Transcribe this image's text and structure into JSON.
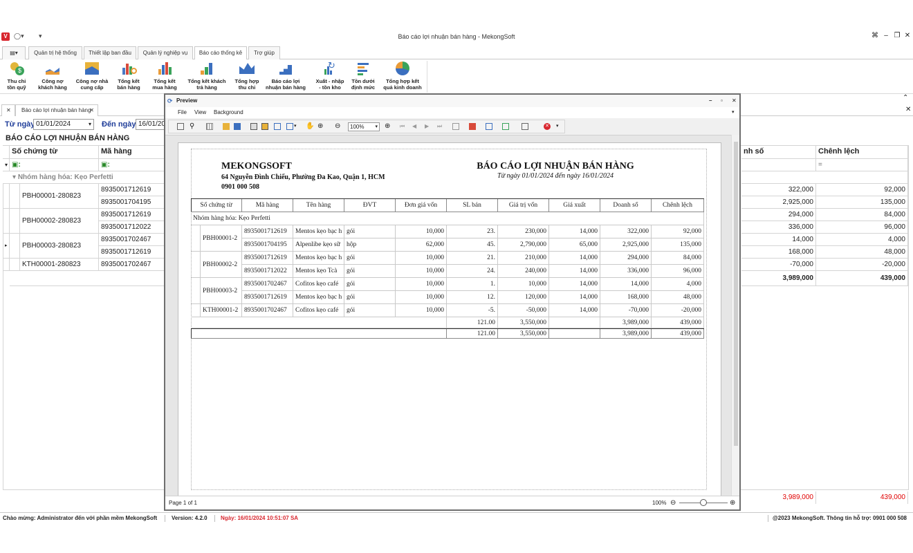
{
  "window": {
    "title": "Báo cáo lợi nhuận bán hàng - MekongSoft"
  },
  "ribbon_tabs": [
    "Quản trị hệ thống",
    "Thiết lập ban đầu",
    "Quản lý nghiệp vụ",
    "Báo cáo thống kê",
    "Trợ giúp"
  ],
  "ribbon_buttons": [
    {
      "l1": "Thu chi",
      "l2": "tồn quỹ"
    },
    {
      "l1": "Công nợ",
      "l2": "khách hàng"
    },
    {
      "l1": "Công nợ nhà",
      "l2": "cung cấp"
    },
    {
      "l1": "Tổng kết",
      "l2": "bán hàng"
    },
    {
      "l1": "Tổng kết",
      "l2": "mua hàng"
    },
    {
      "l1": "Tổng kết khách",
      "l2": "trả hàng"
    },
    {
      "l1": "Tổng hợp",
      "l2": "thu chi"
    },
    {
      "l1": "Báo cáo lợi",
      "l2": "nhuận bán hàng"
    },
    {
      "l1": "Xuất - nhập",
      "l2": "- tồn kho"
    },
    {
      "l1": "Tồn dưới",
      "l2": "định mức"
    },
    {
      "l1": "Tổng hợp kết",
      "l2": "quả kinh doanh"
    }
  ],
  "doc_tab": {
    "label": "Báo cáo lợi nhuận bán hàng"
  },
  "filter": {
    "from_label": "Từ ngày",
    "from_value": "01/01/2024",
    "to_label": "Đến ngày",
    "to_value": "16/01/20"
  },
  "report_heading": "BÁO CÁO LỢI NHUẬN BÁN HÀNG",
  "grid": {
    "col_so_chung_tu": "Số chứng từ",
    "col_ma_hang": "Mã hàng",
    "col_doanh_so": "nh số",
    "col_chenh_lech": "Chênh lệch",
    "filter_symbol": "=",
    "group_label": "Nhóm hàng hóa: Kẹo Perfetti",
    "docs": [
      "PBH00001-280823",
      "PBH00002-280823",
      "PBH00003-280823",
      "KTH00001-280823"
    ],
    "codes": [
      "8935001712619",
      "8935001704195",
      "8935001712619",
      "8935001712022",
      "8935001702467",
      "8935001712619",
      "8935001702467"
    ],
    "doanh_so": [
      "322,000",
      "2,925,000",
      "294,000",
      "336,000",
      "14,000",
      "168,000",
      "-70,000"
    ],
    "chenh_lech": [
      "92,000",
      "135,000",
      "84,000",
      "96,000",
      "4,000",
      "48,000",
      "-20,000"
    ],
    "total_doanh_so": "3,989,000",
    "total_chenh_lech": "439,000",
    "footer_doanh_so": "3,989,000",
    "footer_chenh_lech": "439,000"
  },
  "preview": {
    "title": "Preview",
    "menu": [
      "File",
      "View",
      "Background"
    ],
    "zoom_value": "100%",
    "page_info": "Page 1 of 1",
    "zoom_status": "100%",
    "company": "MEKONGSOFT",
    "address": "64 Nguyễn Đình Chiểu, Phường Đa Kao, Quận 1, HCM",
    "phone": "0901 000 508",
    "report_title": "BÁO CÁO LỢI NHUẬN BÁN HÀNG",
    "report_range": "Từ ngày 01/01/2024 đến ngày 16/01/2024",
    "headers": [
      "Số chứng từ",
      "Mã hàng",
      "Tên hàng",
      "ĐVT",
      "Đơn giá vốn",
      "SL bán",
      "Giá trị vốn",
      "Giá xuất",
      "Doanh số",
      "Chênh lệch"
    ],
    "group": "Nhóm hàng hóa: Kẹo Perfetti",
    "docs": [
      "PBH00001-2",
      "PBH00002-2",
      "PBH00003-2",
      "KTH00001-2"
    ],
    "rows": [
      [
        "8935001712619",
        "Mentos kẹo bạc h",
        "gói",
        "10,000",
        "23.",
        "230,000",
        "14,000",
        "322,000",
        "92,000"
      ],
      [
        "8935001704195",
        "Alpenlibe kẹo sữ",
        "hộp",
        "62,000",
        "45.",
        "2,790,000",
        "65,000",
        "2,925,000",
        "135,000"
      ],
      [
        "8935001712619",
        "Mentos kẹo bạc h",
        "gói",
        "10,000",
        "21.",
        "210,000",
        "14,000",
        "294,000",
        "84,000"
      ],
      [
        "8935001712022",
        "Mentos kẹo Tcà",
        "gói",
        "10,000",
        "24.",
        "240,000",
        "14,000",
        "336,000",
        "96,000"
      ],
      [
        "8935001702467",
        "Cofitos kẹo café",
        "gói",
        "10,000",
        "1.",
        "10,000",
        "14,000",
        "14,000",
        "4,000"
      ],
      [
        "8935001712619",
        "Mentos kẹo bạc h",
        "gói",
        "10,000",
        "12.",
        "120,000",
        "14,000",
        "168,000",
        "48,000"
      ],
      [
        "8935001702467",
        "Cofitos kẹo café",
        "gói",
        "10,000",
        "-5.",
        "-50,000",
        "14,000",
        "-70,000",
        "-20,000"
      ]
    ],
    "subtotal": {
      "sl": "121.00",
      "gtv": "3,550,000",
      "ds": "3,989,000",
      "cl": "439,000"
    },
    "total": {
      "sl": "121.00",
      "gtv": "3,550,000",
      "ds": "3,989,000",
      "cl": "439,000"
    }
  },
  "statusbar": {
    "welcome": "Chào mừng: Administrator đến với phần mềm MekongSoft",
    "version": "Version: 4.2.0",
    "date": "Ngày: 16/01/2024 10:51:07 SA",
    "copyright": "@2023 MekongSoft. Thông tin hỗ trợ: 0901 000 508"
  },
  "colors": {
    "accent_blue": "#1f3d99",
    "red": "#d8262e",
    "footer_red": "#e00000"
  }
}
